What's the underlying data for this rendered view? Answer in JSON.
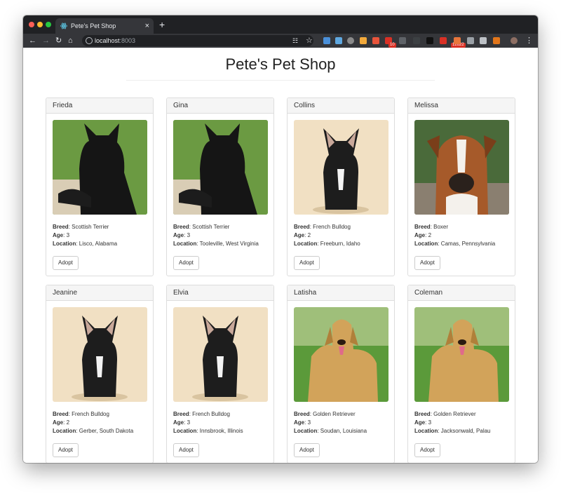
{
  "browser": {
    "tab_title": "Pete's Pet Shop",
    "tab_close": "×",
    "new_tab": "+",
    "url_host": "localhost",
    "url_port": ":8003",
    "badges": [
      "10",
      "12622"
    ]
  },
  "page": {
    "title": "Pete's Pet Shop"
  },
  "labels": {
    "breed": "Breed",
    "age": "Age",
    "location": "Location",
    "adopt": "Adopt"
  },
  "pets": [
    {
      "name": "Frieda",
      "breed": "Scottish Terrier",
      "age": "3",
      "location": "Lisco, Alabama",
      "photo": "scottish-terrier"
    },
    {
      "name": "Gina",
      "breed": "Scottish Terrier",
      "age": "3",
      "location": "Tooleville, West Virginia",
      "photo": "scottish-terrier"
    },
    {
      "name": "Collins",
      "breed": "French Bulldog",
      "age": "2",
      "location": "Freeburn, Idaho",
      "photo": "french-bulldog"
    },
    {
      "name": "Melissa",
      "breed": "Boxer",
      "age": "2",
      "location": "Camas, Pennsylvania",
      "photo": "boxer"
    },
    {
      "name": "Jeanine",
      "breed": "French Bulldog",
      "age": "2",
      "location": "Gerber, South Dakota",
      "photo": "french-bulldog"
    },
    {
      "name": "Elvia",
      "breed": "French Bulldog",
      "age": "3",
      "location": "Innsbrook, Illinois",
      "photo": "french-bulldog"
    },
    {
      "name": "Latisha",
      "breed": "Golden Retriever",
      "age": "3",
      "location": "Soudan, Louisiana",
      "photo": "golden-retriever"
    },
    {
      "name": "Coleman",
      "breed": "Golden Retriever",
      "age": "3",
      "location": "Jacksonwald, Palau",
      "photo": "golden-retriever"
    }
  ]
}
